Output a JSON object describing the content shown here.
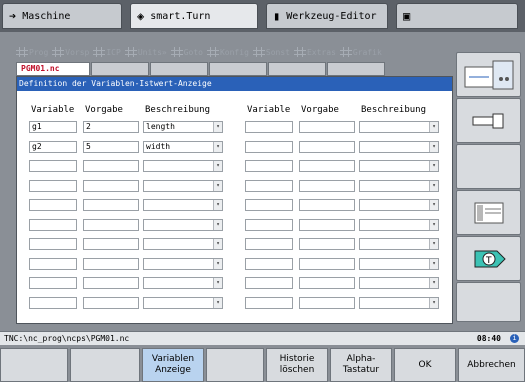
{
  "tabs": [
    {
      "label": "Maschine",
      "icon": "arrow-right-icon"
    },
    {
      "label": "smart.Turn",
      "icon": "diamond-arrow-icon"
    },
    {
      "label": "Werkzeug-Editor",
      "icon": "tool-icon"
    },
    {
      "label": "",
      "icon": "save-icon"
    }
  ],
  "menu": [
    "Prog",
    "Vorsp",
    "ICP",
    "Units»",
    "Goto",
    "Konfig",
    "Sonst",
    "Extras",
    "Grafik"
  ],
  "doc_tab": "PGM01.nc",
  "dialog": {
    "title": "Definition der Variablen-Istwert-Anzeige",
    "col_variable": "Variable",
    "col_vorgabe": "Vorgabe",
    "col_beschreibung": "Beschreibung",
    "rows_left": [
      {
        "variable": "g1",
        "vorgabe": "2",
        "beschreibung": "length"
      },
      {
        "variable": "g2",
        "vorgabe": "5",
        "beschreibung": "width"
      },
      {
        "variable": "",
        "vorgabe": "",
        "beschreibung": ""
      },
      {
        "variable": "",
        "vorgabe": "",
        "beschreibung": ""
      },
      {
        "variable": "",
        "vorgabe": "",
        "beschreibung": ""
      },
      {
        "variable": "",
        "vorgabe": "",
        "beschreibung": ""
      },
      {
        "variable": "",
        "vorgabe": "",
        "beschreibung": ""
      },
      {
        "variable": "",
        "vorgabe": "",
        "beschreibung": ""
      },
      {
        "variable": "",
        "vorgabe": "",
        "beschreibung": ""
      },
      {
        "variable": "",
        "vorgabe": "",
        "beschreibung": ""
      }
    ]
  },
  "status": {
    "path": "TNC:\\nc_prog\\ncps\\PGM01.nc",
    "clock": "08:40",
    "info": "i"
  },
  "softkeys": [
    "",
    "",
    "Variablen\nAnzeige",
    "",
    "Historie\nlöschen",
    "Alpha-\nTastatur",
    "OK",
    "Abbrechen"
  ],
  "colors": {
    "title_bar": "#2a61b8",
    "doc_tab_text": "#c0102a",
    "active_softkey": "#b9d3ef"
  }
}
